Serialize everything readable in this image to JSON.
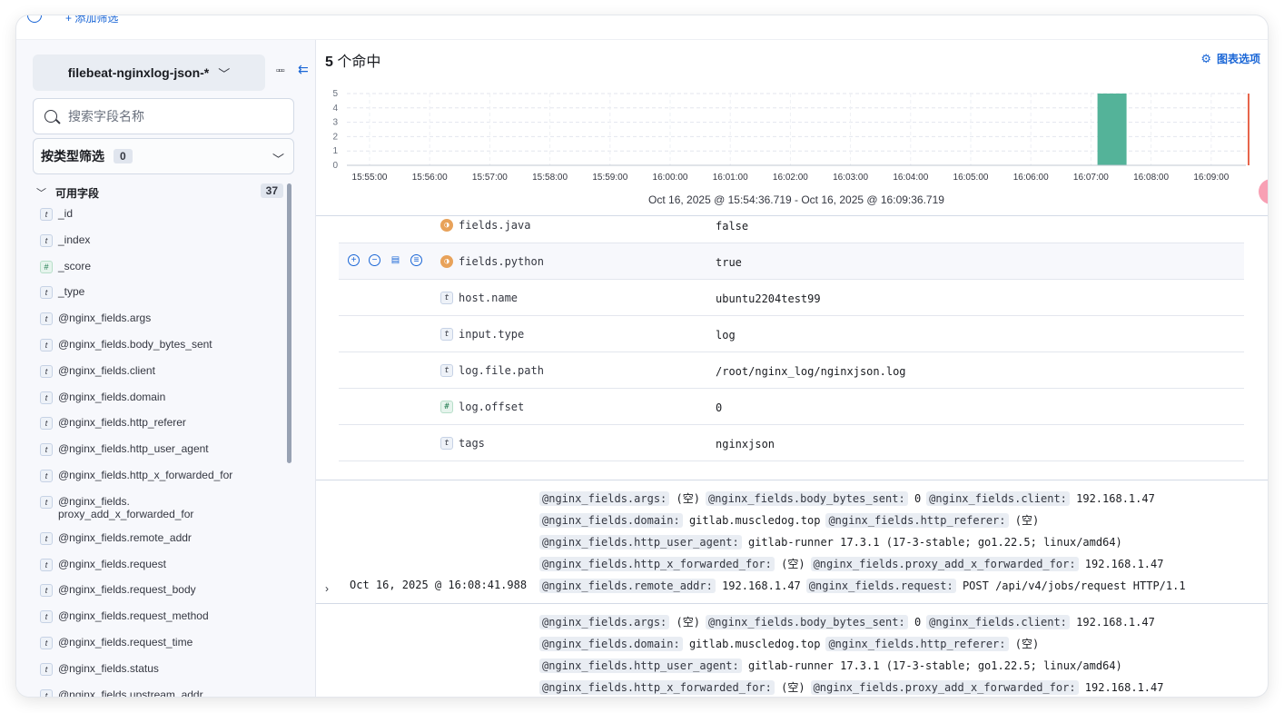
{
  "topbar": {
    "add_filter": "+ 添加筛选"
  },
  "sidebar": {
    "data_view": "filebeat-nginxlog-json-*",
    "search_placeholder": "搜索字段名称",
    "type_filter_label": "按类型筛选",
    "type_filter_count": "0",
    "available_label": "可用字段",
    "available_count": "37",
    "fields": [
      {
        "type": "t",
        "name": "_id"
      },
      {
        "type": "t",
        "name": "_index"
      },
      {
        "type": "#",
        "name": "_score"
      },
      {
        "type": "t",
        "name": "_type"
      },
      {
        "type": "t",
        "name": "@nginx_fields.args"
      },
      {
        "type": "t",
        "name": "@nginx_fields.body_bytes_sent"
      },
      {
        "type": "t",
        "name": "@nginx_fields.client"
      },
      {
        "type": "t",
        "name": "@nginx_fields.domain"
      },
      {
        "type": "t",
        "name": "@nginx_fields.http_referer"
      },
      {
        "type": "t",
        "name": "@nginx_fields.http_user_agent"
      },
      {
        "type": "t",
        "name": "@nginx_fields.http_x_forwarded_for"
      },
      {
        "type": "t",
        "name": "@nginx_fields.\nproxy_add_x_forwarded_for"
      },
      {
        "type": "t",
        "name": "@nginx_fields.remote_addr"
      },
      {
        "type": "t",
        "name": "@nginx_fields.request"
      },
      {
        "type": "t",
        "name": "@nginx_fields.request_body"
      },
      {
        "type": "t",
        "name": "@nginx_fields.request_method"
      },
      {
        "type": "t",
        "name": "@nginx_fields.request_time"
      },
      {
        "type": "t",
        "name": "@nginx_fields.status"
      },
      {
        "type": "t",
        "name": "@nginx_fields.upstream_addr"
      }
    ]
  },
  "main": {
    "hits_count": "5",
    "hits_label": " 个命中",
    "chart_options": "图表选项",
    "time_range": "Oct 16, 2025 @ 15:54:36.719 - Oct 16, 2025 @ 16:09:36.719"
  },
  "chart_data": {
    "type": "bar",
    "categories": [
      "15:55:00",
      "15:56:00",
      "15:57:00",
      "15:58:00",
      "15:59:00",
      "16:00:00",
      "16:01:00",
      "16:02:00",
      "16:03:00",
      "16:04:00",
      "16:05:00",
      "16:06:00",
      "16:07:00",
      "16:08:00",
      "16:09:00"
    ],
    "values": [
      0,
      0,
      0,
      0,
      0,
      0,
      0,
      0,
      0,
      0,
      0,
      0,
      0,
      5,
      0
    ],
    "yticks": [
      "0",
      "1",
      "2",
      "3",
      "4",
      "5"
    ],
    "ylim": [
      0,
      5
    ],
    "bar_color": "#54b399",
    "marker_color": "#e7664c"
  },
  "doc_fields": [
    {
      "type": "bool",
      "name": "fields.java",
      "value": "false"
    },
    {
      "type": "bool",
      "name": "fields.python",
      "value": "true"
    },
    {
      "type": "t",
      "name": "host.name",
      "value": "ubuntu2204test99"
    },
    {
      "type": "t",
      "name": "input.type",
      "value": "log"
    },
    {
      "type": "t",
      "name": "log.file.path",
      "value": "/root/nginx_log/nginxjson.log"
    },
    {
      "type": "#",
      "name": "log.offset",
      "value": "0"
    },
    {
      "type": "t",
      "name": "tags",
      "value": "nginxjson"
    }
  ],
  "log_rows": [
    {
      "timestamp": "Oct 16, 2025 @ 16:08:41.988",
      "lines": [
        [
          [
            "@nginx_fields.args:",
            "(空)"
          ],
          [
            "@nginx_fields.body_bytes_sent:",
            "0"
          ],
          [
            "@nginx_fields.client:",
            "192.168.1.47"
          ]
        ],
        [
          [
            "@nginx_fields.domain:",
            "gitlab.muscledog.top"
          ],
          [
            "@nginx_fields.http_referer:",
            "(空)"
          ]
        ],
        [
          [
            "@nginx_fields.http_user_agent:",
            "gitlab-runner 17.3.1 (17-3-stable; go1.22.5; linux/amd64)"
          ]
        ],
        [
          [
            "@nginx_fields.http_x_forwarded_for:",
            "(空)"
          ],
          [
            "@nginx_fields.proxy_add_x_forwarded_for:",
            "192.168.1.47"
          ]
        ],
        [
          [
            "@nginx_fields.remote_addr:",
            "192.168.1.47"
          ],
          [
            "@nginx_fields.request:",
            "POST /api/v4/jobs/request HTTP/1.1"
          ]
        ]
      ]
    },
    {
      "timestamp": "",
      "lines": [
        [
          [
            "@nginx_fields.args:",
            "(空)"
          ],
          [
            "@nginx_fields.body_bytes_sent:",
            "0"
          ],
          [
            "@nginx_fields.client:",
            "192.168.1.47"
          ]
        ],
        [
          [
            "@nginx_fields.domain:",
            "gitlab.muscledog.top"
          ],
          [
            "@nginx_fields.http_referer:",
            "(空)"
          ]
        ],
        [
          [
            "@nginx_fields.http_user_agent:",
            "gitlab-runner 17.3.1 (17-3-stable; go1.22.5; linux/amd64)"
          ]
        ],
        [
          [
            "@nginx_fields.http_x_forwarded_for:",
            "(空)"
          ],
          [
            "@nginx_fields.proxy_add_x_forwarded_for:",
            "192.168.1.47"
          ]
        ]
      ]
    }
  ]
}
